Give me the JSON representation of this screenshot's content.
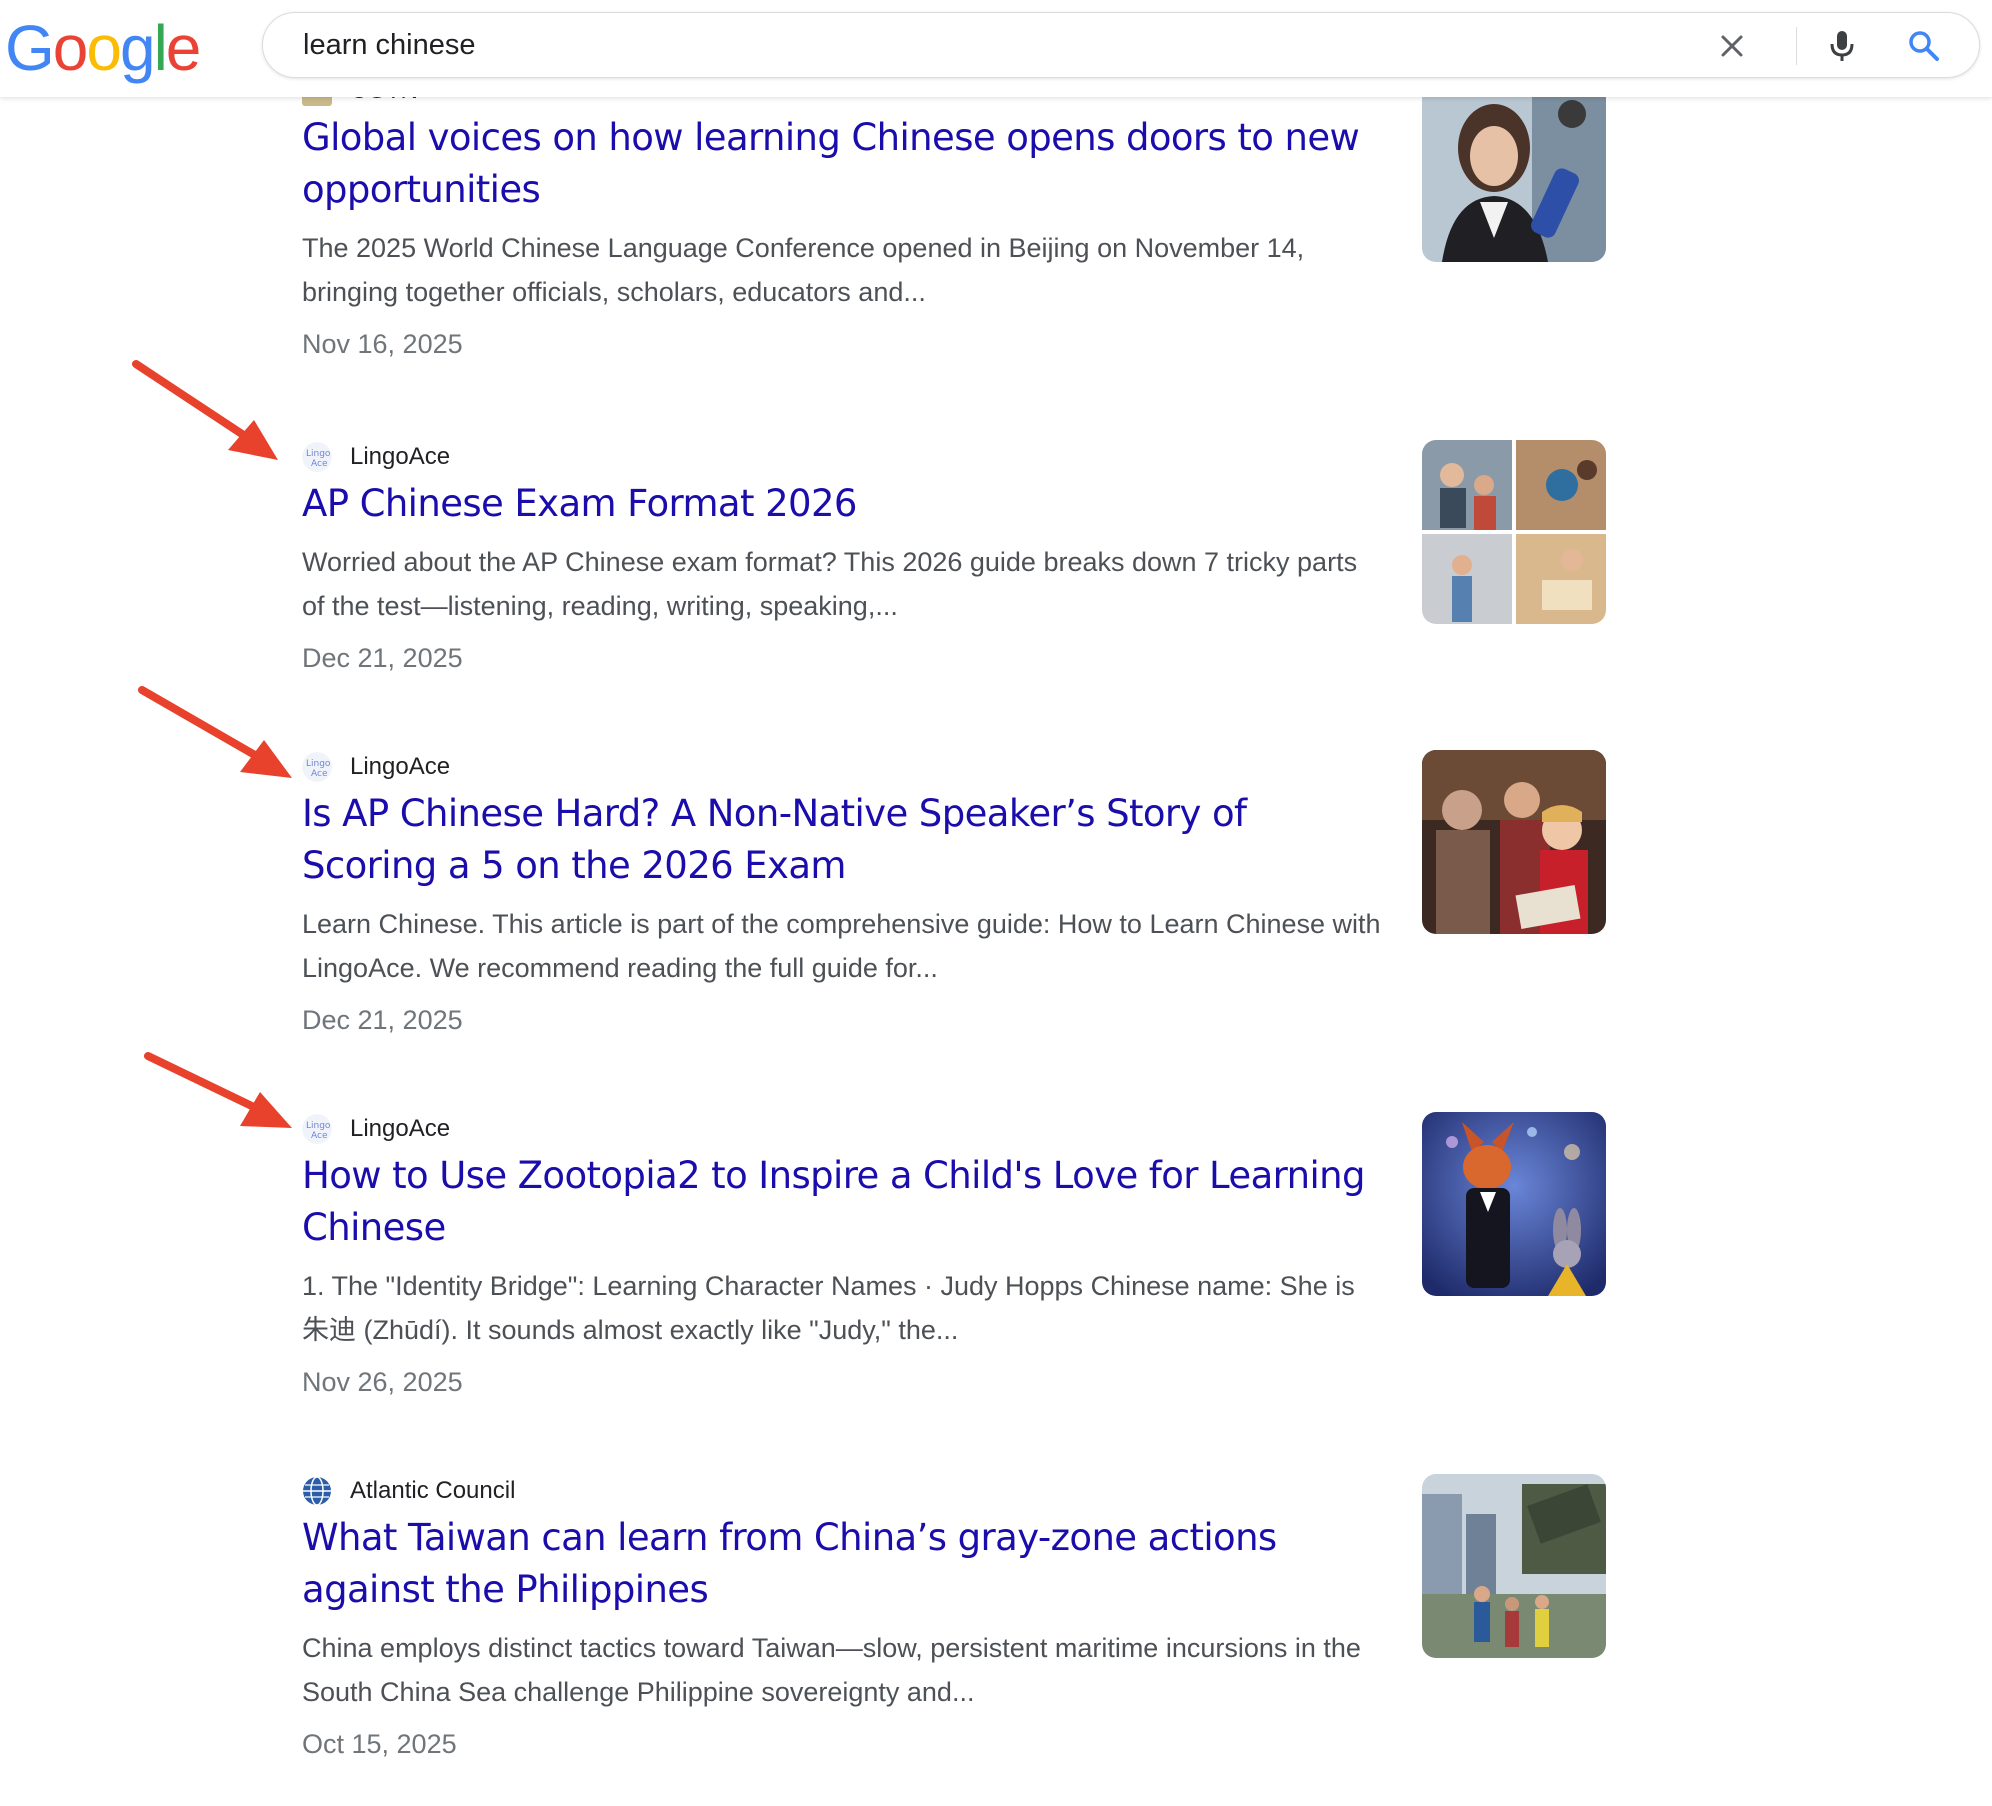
{
  "search": {
    "query": "learn chinese"
  },
  "logo": {
    "letters": [
      "G",
      "o",
      "o",
      "g",
      "l",
      "e"
    ],
    "colors": [
      "#4285F4",
      "#EA4335",
      "#FBBC05",
      "#4285F4",
      "#34A853",
      "#EA4335"
    ]
  },
  "icons": {
    "clear": "close-icon",
    "voice": "microphone-icon",
    "search": "search-icon",
    "annotation": "red-arrow-icon"
  },
  "colors": {
    "link": "#1a0dab",
    "snippet": "#4d5156",
    "date": "#70757a",
    "arrow": "#e8412c"
  },
  "results": [
    {
      "site": "CGTN",
      "title": "Global voices on how learning Chinese opens doors to new opportunities",
      "snippet": "The 2025 World Chinese Language Conference opened in Beijing on November 14, bringing together officials, scholars, educators and...",
      "date": "Nov 16, 2025",
      "thumbnail": "photo of young woman speaking into CGTN microphone",
      "highlighted": false
    },
    {
      "site": "LingoAce",
      "title": "AP Chinese Exam Format 2026",
      "snippet": "Worried about the AP Chinese exam format? This 2026 guide breaks down 7 tricky parts of the test—listening, reading, writing, speaking,...",
      "date": "Dec 21, 2025",
      "thumbnail": "collage of classroom teaching scenes",
      "highlighted": true
    },
    {
      "site": "LingoAce",
      "title": "Is AP Chinese Hard? A Non-Native Speaker’s Story of Scoring a 5 on the 2026 Exam",
      "snippet": "Learn Chinese. This article is part of the comprehensive guide: How to Learn Chinese with LingoAce. We recommend reading the full guide for...",
      "date": "Dec 21, 2025",
      "thumbnail": "family reading a book together",
      "highlighted": true
    },
    {
      "site": "LingoAce",
      "title": "How to Use Zootopia2 to Inspire a Child's Love for Learning Chinese",
      "snippet": "1. The \"Identity Bridge\": Learning Character Names · Judy Hopps Chinese name: She is 朱迪 (Zhūdí). It sounds almost exactly like \"Judy,\" the...",
      "date": "Nov 26, 2025",
      "thumbnail": "animated fox and rabbit characters",
      "highlighted": true
    },
    {
      "site": "Atlantic Council",
      "title": "What Taiwan can learn from China’s gray-zone actions against the Philippines",
      "snippet": "China employs distinct tactics toward Taiwan—slow, persistent maritime incursions in the South China Sea challenge Philippine sovereignty and...",
      "date": "Oct 15, 2025",
      "thumbnail": "missile launcher in city street",
      "highlighted": false
    }
  ]
}
